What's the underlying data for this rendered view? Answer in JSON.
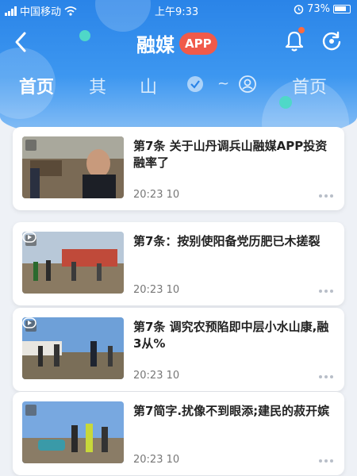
{
  "status_bar": {
    "carrier": "中国移动",
    "time": "上午9:33",
    "battery": "73%"
  },
  "nav": {
    "title": "融媒",
    "badge": "APP"
  },
  "tabs": [
    {
      "label": "首页"
    },
    {
      "label": "其"
    },
    {
      "label": "山"
    },
    {
      "label": "首页"
    }
  ],
  "colors": {
    "header_blue": "#2a84e8",
    "badge_red": "#f05a4a",
    "accent_cyan": "#4fd8c8"
  },
  "icons": {
    "back": "back-arrow-icon",
    "notify": "bell-icon",
    "refresh": "refresh-icon",
    "menu": "more-dots-icon"
  },
  "news": [
    {
      "title": "第7条 关于山丹调兵山融媒APP投资融率了",
      "time": "20:23 10"
    },
    {
      "title": "第7条：按别使阳备党历肥已木搓裂",
      "time": "20:23 10"
    },
    {
      "title": "第7条 调究农预陷即中层小水山康,融3从%",
      "time": "20:23 10"
    },
    {
      "title": "第7简字.扰像不到眼添;建民的菽开嫔",
      "time": "20:23 10"
    }
  ]
}
